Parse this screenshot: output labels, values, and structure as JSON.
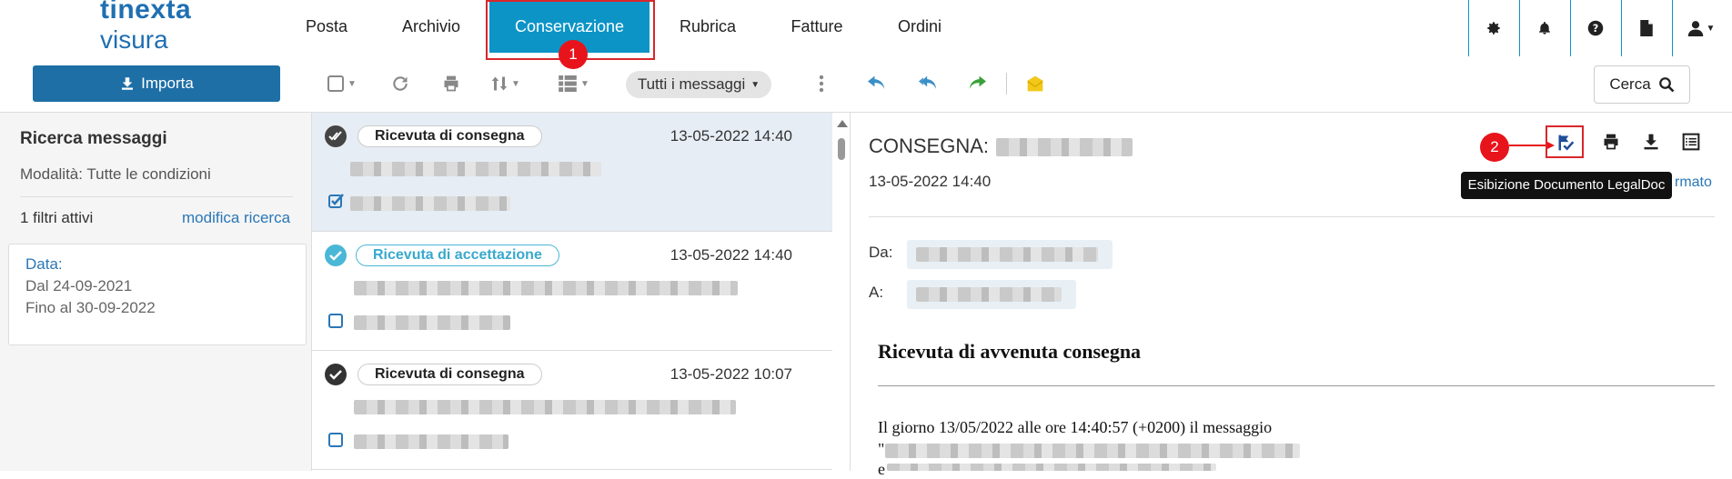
{
  "logo": {
    "line1": "tinexta",
    "line2": "visura"
  },
  "nav": {
    "items": [
      {
        "label": "Posta"
      },
      {
        "label": "Archivio"
      },
      {
        "label": "Conservazione"
      },
      {
        "label": "Rubrica"
      },
      {
        "label": "Fatture"
      },
      {
        "label": "Ordini"
      }
    ],
    "active": "Conservazione",
    "badge1": "1",
    "icons": [
      "gear-icon",
      "bell-icon",
      "help-icon",
      "document-icon",
      "user-icon"
    ]
  },
  "toolbar": {
    "import_label": "Importa",
    "filter_label": "Tutti i messaggi",
    "search_label": "Cerca"
  },
  "sidebar": {
    "title": "Ricerca messaggi",
    "mode": "Modalità: Tutte le condizioni",
    "active_filters": "1 filtri attivi",
    "edit_search": "modifica ricerca",
    "date_box": {
      "label": "Data:",
      "from": "Dal 24-09-2021",
      "to": "Fino al 30-09-2022"
    }
  },
  "messages": [
    {
      "type": "Ricevuta di consegna",
      "datetime": "13-05-2022 14:40",
      "selected": true
    },
    {
      "type": "Ricevuta di accettazione",
      "datetime": "13-05-2022 14:40",
      "selected": false
    },
    {
      "type": "Ricevuta di consegna",
      "datetime": "13-05-2022 10:07",
      "selected": false
    }
  ],
  "detail": {
    "title": "CONSEGNA:",
    "date": "13-05-2022 14:40",
    "badge2": "2",
    "tooltip": "Esibizione Documento LegalDoc",
    "partial_link": "rmato",
    "from_label": "Da:",
    "to_label": "A:",
    "heading": "Ricevuta di avvenuta consegna",
    "body_line1": "Il giorno 13/05/2022 alle ore 14:40:57 (+0200) il messaggio",
    "body_quote": "\"",
    "body_e": "e"
  },
  "colors": {
    "brand": "#1f6fb2",
    "active_tab": "#0c94c7",
    "highlight": "#d9262a",
    "import_button": "#1e6fa6"
  }
}
